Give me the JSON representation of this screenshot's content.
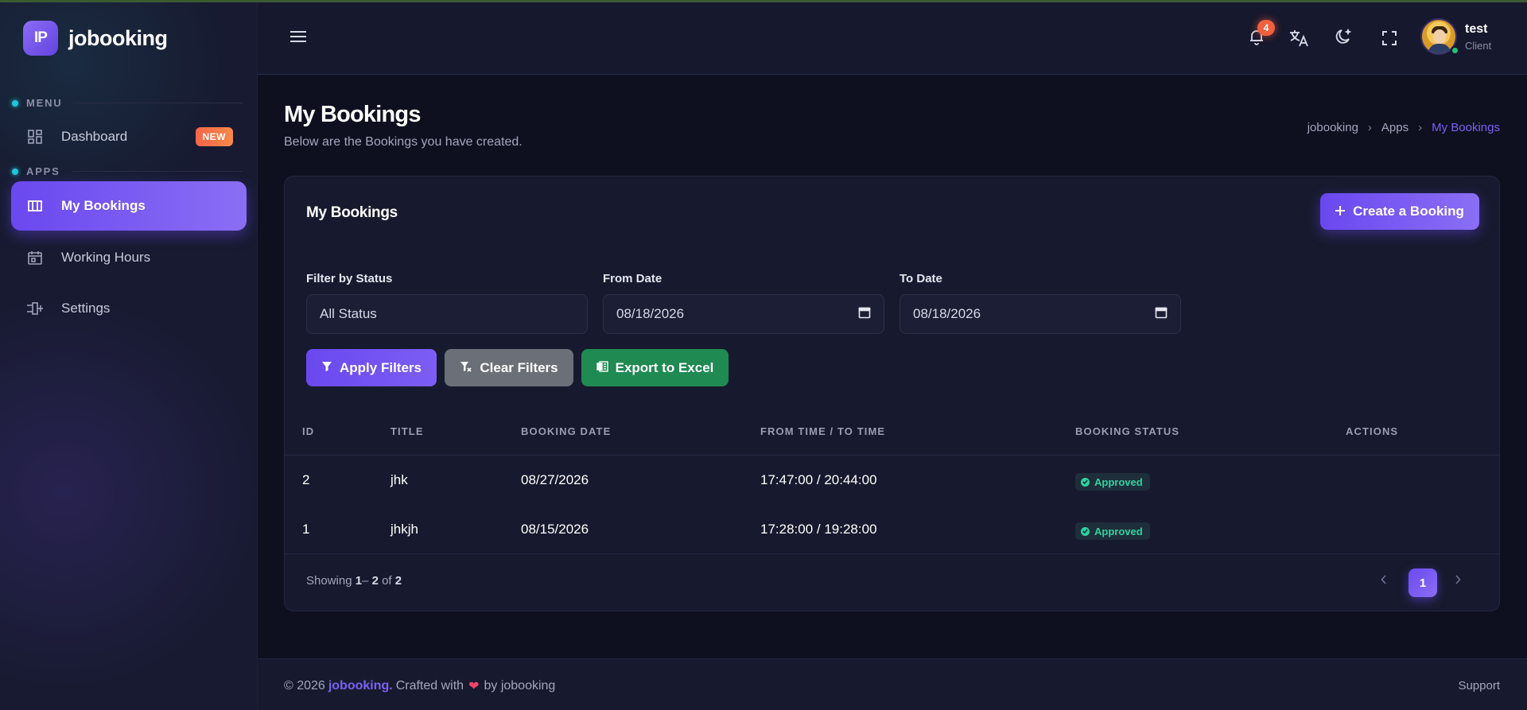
{
  "app": {
    "logo_text": "IP",
    "name": "jobooking"
  },
  "sidebar": {
    "menu_label": "MENU",
    "apps_label": "APPS",
    "items": [
      {
        "label": "Dashboard",
        "badge": "NEW",
        "icon": "dashboard-icon"
      },
      {
        "label": "My Bookings",
        "icon": "columns-icon",
        "active": true
      },
      {
        "label": "Working Hours",
        "icon": "calendar-icon"
      },
      {
        "label": "Settings",
        "icon": "settings-icon"
      }
    ]
  },
  "header": {
    "notification_count": "4",
    "user": {
      "name": "test",
      "role": "Client"
    },
    "icons": [
      "menu-icon",
      "bell-icon",
      "translate-icon",
      "moon-icon",
      "fullscreen-icon"
    ]
  },
  "page": {
    "title": "My Bookings",
    "subtitle": "Below are the Bookings you have created.",
    "breadcrumb": [
      "jobooking",
      "Apps",
      "My Bookings"
    ]
  },
  "card": {
    "title": "My Bookings",
    "create_button": "Create a Booking",
    "filters": {
      "status_label": "Filter by Status",
      "status_value": "All Status",
      "from_label": "From Date",
      "from_value": "08/18/2026",
      "to_label": "To Date",
      "to_value": "08/18/2026"
    },
    "buttons": {
      "apply": "Apply Filters",
      "clear": "Clear Filters",
      "export": "Export to Excel"
    },
    "table": {
      "columns": [
        "ID",
        "TITLE",
        "BOOKING DATE",
        "FROM TIME / TO TIME",
        "BOOKING STATUS",
        "ACTIONS"
      ],
      "rows": [
        {
          "id": "2",
          "title": "jhk",
          "date": "08/27/2026",
          "time": "17:47:00 / 20:44:00",
          "status": "Approved"
        },
        {
          "id": "1",
          "title": "jhkjh",
          "date": "08/15/2026",
          "time": "17:28:00 / 19:28:00",
          "status": "Approved"
        }
      ]
    },
    "pagination": {
      "showing_prefix": "Showing",
      "from": "1",
      "to": "2",
      "of_label": "of",
      "total": "2",
      "current_page": "1"
    }
  },
  "footer": {
    "copyright": "© 2026",
    "brand": "jobooking.",
    "crafted": "Crafted with",
    "by": "by jobooking",
    "support": "Support"
  },
  "colors": {
    "accent": "#6a48f0",
    "success": "#2ed3a0",
    "export": "#1f8a52",
    "danger": "#f0603f"
  }
}
